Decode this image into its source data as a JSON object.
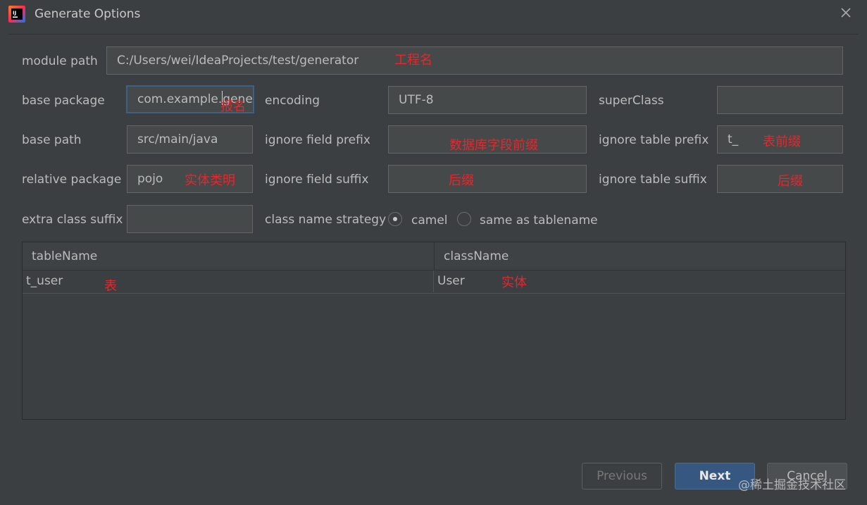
{
  "window": {
    "title": "Generate Options"
  },
  "form": {
    "module_path": {
      "label": "module path",
      "value": "C:/Users/wei/IdeaProjects/test/generator"
    },
    "base_package": {
      "label": "base package",
      "value_before_caret": "com.example.",
      "value_after_caret": "gene"
    },
    "encoding": {
      "label": "encoding",
      "value": "UTF-8"
    },
    "super_class": {
      "label": "superClass",
      "value": ""
    },
    "base_path": {
      "label": "base path",
      "value": "src/main/java"
    },
    "ignore_field_prefix": {
      "label": "ignore field prefix",
      "value": ""
    },
    "ignore_table_prefix": {
      "label": "ignore table prefix",
      "value": "t_"
    },
    "relative_package": {
      "label": "relative package",
      "value": "pojo"
    },
    "ignore_field_suffix": {
      "label": "ignore field suffix",
      "value": ""
    },
    "ignore_table_suffix": {
      "label": "ignore table suffix",
      "value": ""
    },
    "extra_class_suffix": {
      "label": "extra class suffix",
      "value": ""
    },
    "class_name_strategy": {
      "label": "class name strategy",
      "options": [
        "camel",
        "same as tablename"
      ],
      "selected": "camel"
    }
  },
  "annotations": {
    "module_path": "工程名",
    "base_package": "报名",
    "ignore_field_prefix": "数据库字段前缀",
    "ignore_table_prefix": "表前缀",
    "relative_package": "实体类明",
    "ignore_field_suffix": "后缀",
    "ignore_table_suffix": "后缀",
    "table_name": "表",
    "class_name": "实体"
  },
  "table": {
    "columns": [
      "tableName",
      "className"
    ],
    "rows": [
      {
        "tableName": "t_user",
        "className": "User"
      }
    ]
  },
  "buttons": {
    "previous": "Previous",
    "next": "Next",
    "cancel": "Cancel"
  },
  "watermark": "@稀土掘金技术社区",
  "colors": {
    "background": "#3c3f41",
    "field_bg": "#45494a",
    "accent_blue": "#365880",
    "annotation_red": "#e8262b"
  }
}
